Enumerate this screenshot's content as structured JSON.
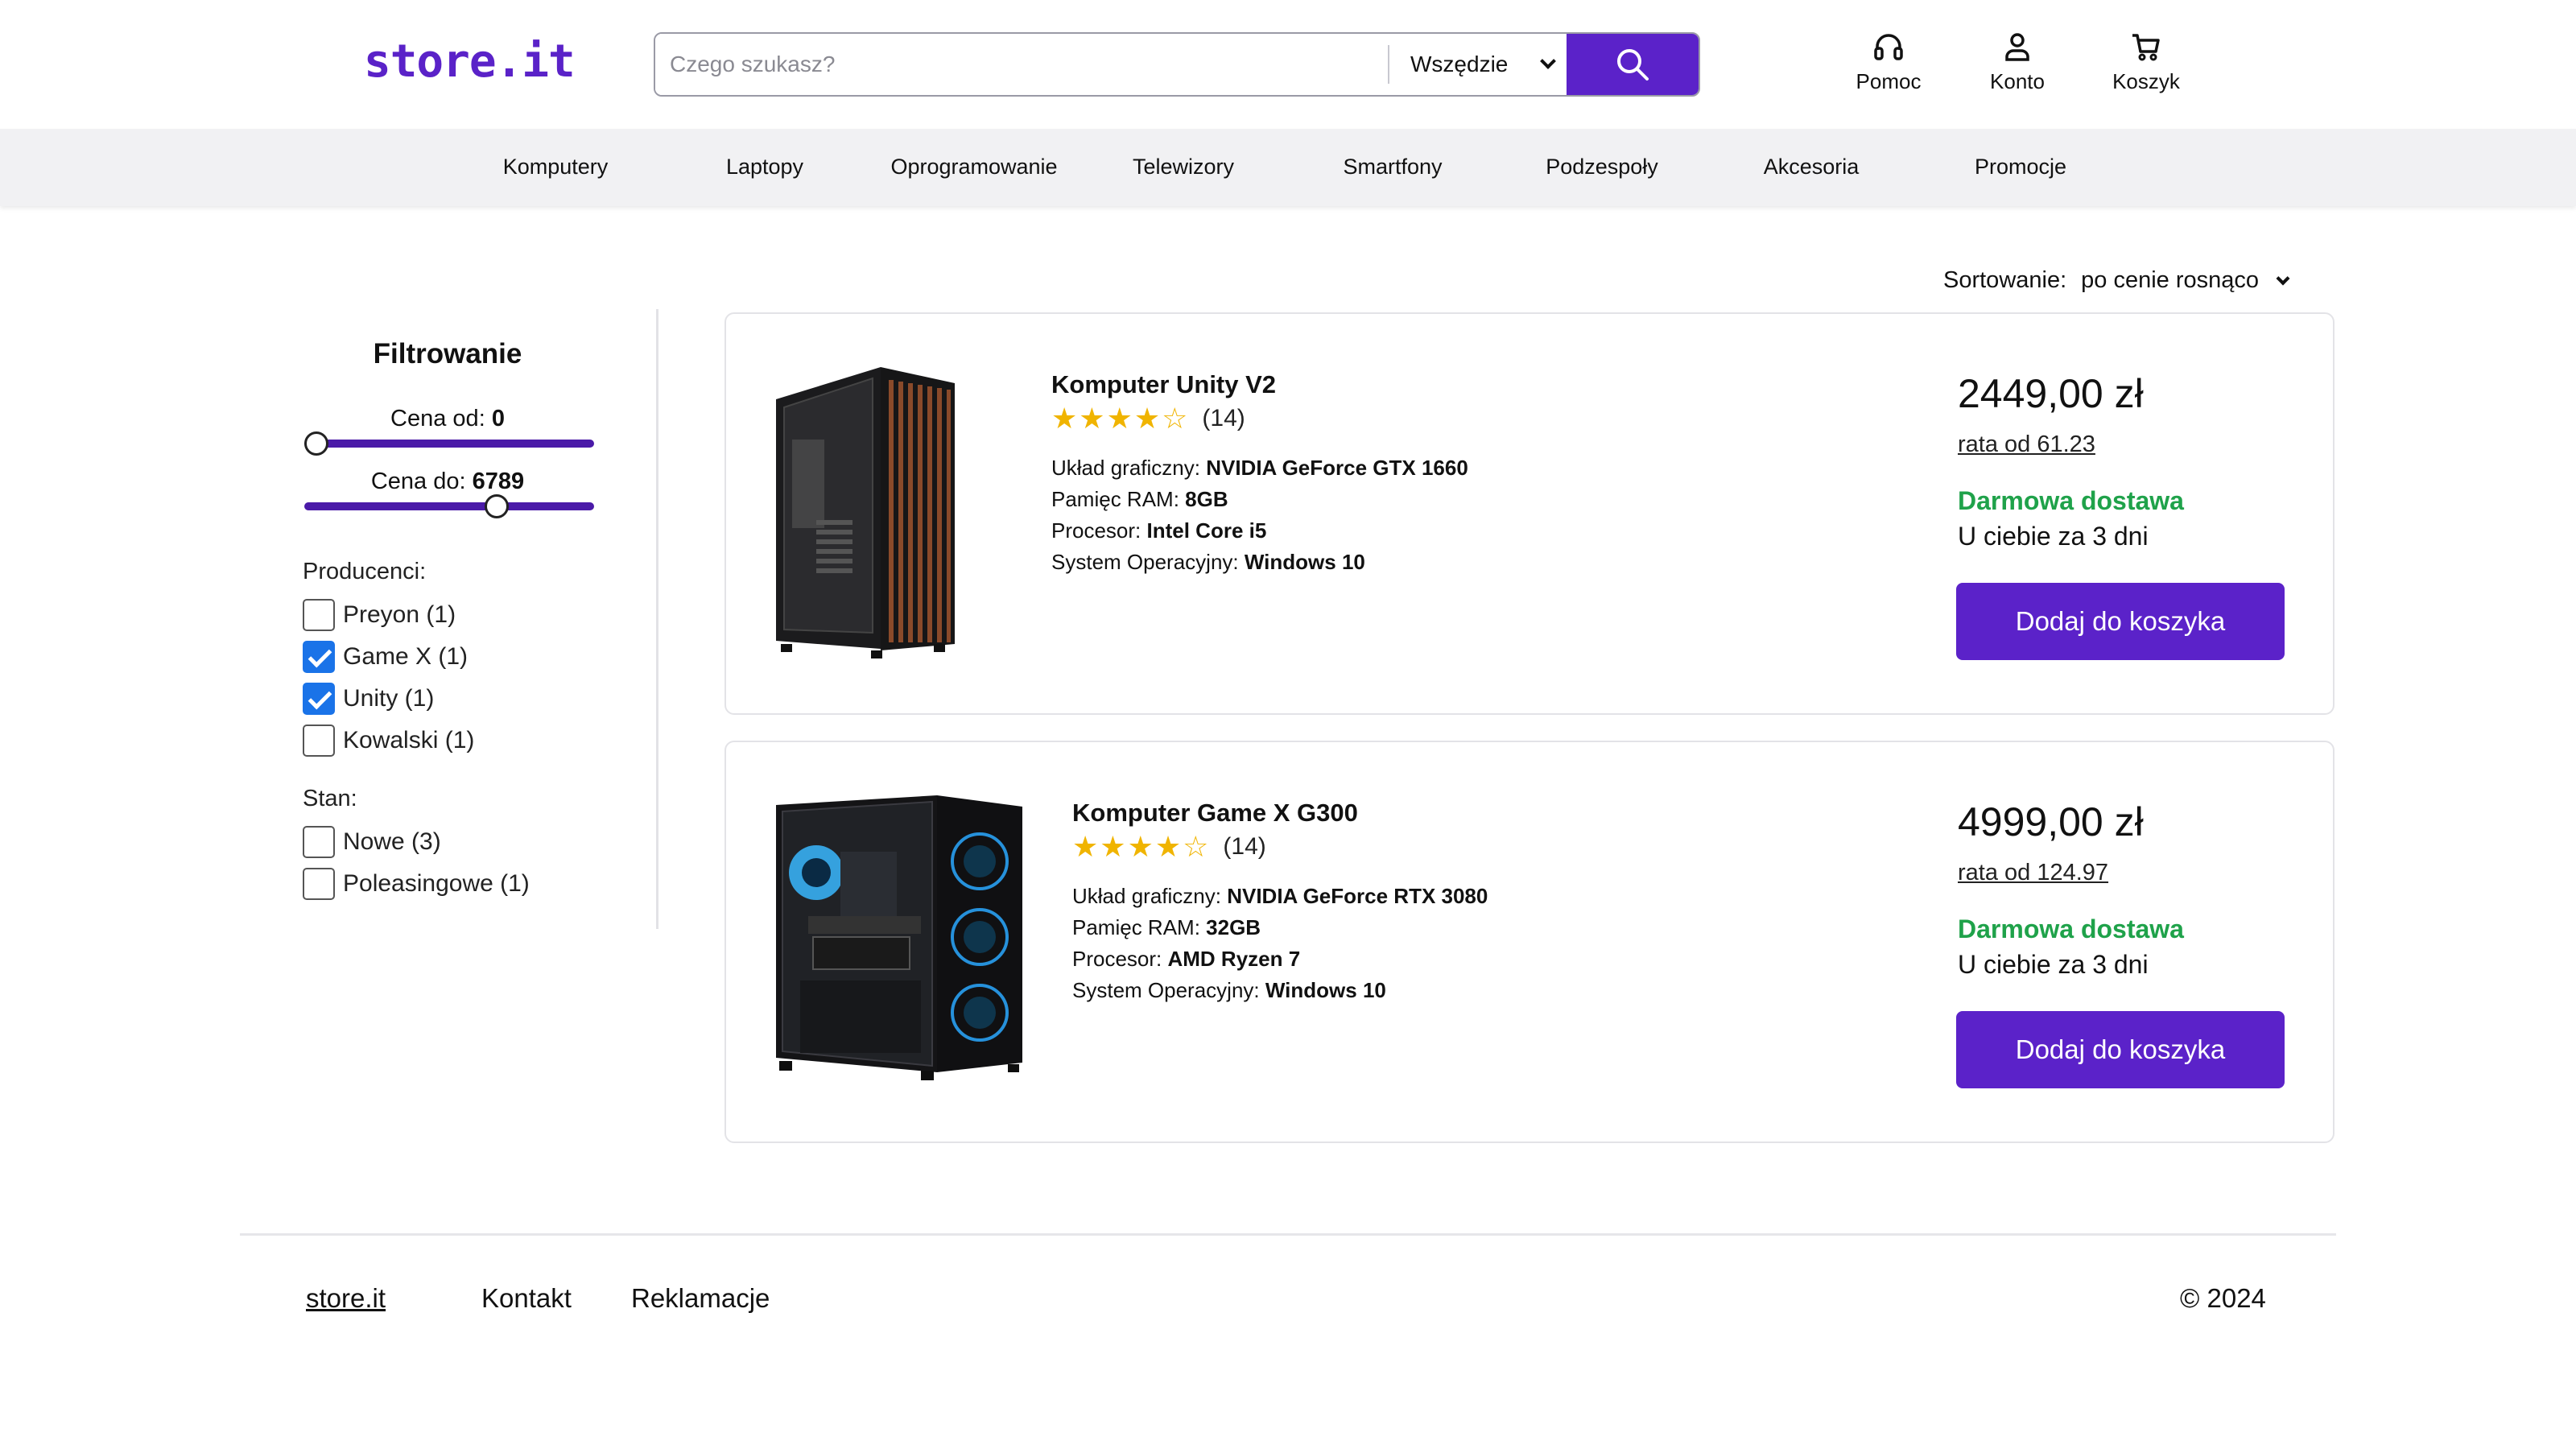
{
  "header": {
    "logo": "store.it",
    "search_placeholder": "Czego szukasz?",
    "search_scope": "Wszędzie",
    "icons": [
      {
        "label": "Pomoc",
        "icon": "headphones-icon"
      },
      {
        "label": "Konto",
        "icon": "user-icon"
      },
      {
        "label": "Koszyk",
        "icon": "cart-icon"
      }
    ]
  },
  "nav": {
    "items": [
      "Komputery",
      "Laptopy",
      "Oprogramowanie",
      "Telewizory",
      "Smartfony",
      "Podzespoły",
      "Akcesoria",
      "Promocje"
    ]
  },
  "sort": {
    "label": "Sortowanie:",
    "value": "po cenie rosnąco"
  },
  "filters": {
    "title": "Filtrowanie",
    "price_from_label": "Cena od:",
    "price_from_value": "0",
    "price_to_label": "Cena do:",
    "price_to_value": "6789",
    "price_max": 10000,
    "manufacturers_label": "Producenci:",
    "manufacturers": [
      {
        "label": "Preyon (1)",
        "checked": false
      },
      {
        "label": "Game X (1)",
        "checked": true
      },
      {
        "label": "Unity (1)",
        "checked": true
      },
      {
        "label": "Kowalski (1)",
        "checked": false
      }
    ],
    "condition_label": "Stan:",
    "conditions": [
      {
        "label": "Nowe (3)",
        "checked": false
      },
      {
        "label": "Poleasingowe (1)",
        "checked": false
      }
    ]
  },
  "products": [
    {
      "name": "Komputer Unity V2",
      "rating": 4,
      "reviews": "(14)",
      "specs": [
        {
          "label": "Układ graficzny:",
          "value": "NVIDIA GeForce GTX 1660"
        },
        {
          "label": "Pamięc RAM:",
          "value": "8GB"
        },
        {
          "label": "Procesor:",
          "value": "Intel Core i5"
        },
        {
          "label": "System Operacyjny:",
          "value": "Windows 10"
        }
      ],
      "price": "2449,00 zł",
      "installment": "rata od 61.23",
      "shipping": "Darmowa dostawa",
      "delivery": "U ciebie za 3 dni",
      "button": "Dodaj do koszyka"
    },
    {
      "name": "Komputer Game X G300",
      "rating": 4,
      "reviews": "(14)",
      "specs": [
        {
          "label": "Układ graficzny:",
          "value": "NVIDIA GeForce RTX 3080"
        },
        {
          "label": "Pamięc RAM:",
          "value": "32GB"
        },
        {
          "label": "Procesor:",
          "value": "AMD Ryzen 7"
        },
        {
          "label": "System Operacyjny:",
          "value": "Windows 10"
        }
      ],
      "price": "4999,00 zł",
      "installment": "rata od 124.97",
      "shipping": "Darmowa dostawa",
      "delivery": "U ciebie za 3 dni",
      "button": "Dodaj do koszyka"
    }
  ],
  "footer": {
    "brand": "store.it",
    "links": [
      "Kontakt",
      "Reklamacje"
    ],
    "copyright": "© 2024"
  },
  "colors": {
    "accent": "#5b22c9",
    "success": "#1fa24a",
    "star": "#f0b400",
    "nav_bg": "#f1f1f3"
  }
}
